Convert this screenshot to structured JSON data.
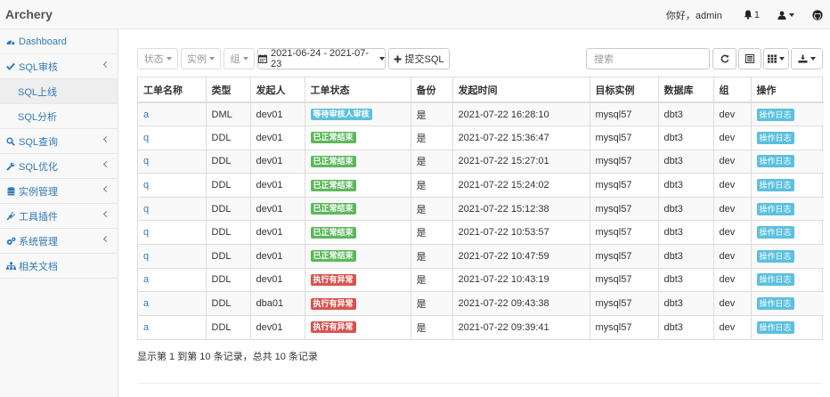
{
  "navbar": {
    "brand": "Archery",
    "greeting": "你好，admin",
    "notification_count": "1"
  },
  "sidebar": {
    "items": [
      {
        "label": "Dashboard",
        "icon": "dashboard-icon"
      },
      {
        "label": "SQL审核",
        "icon": "check-icon"
      },
      {
        "label": "SQL上线"
      },
      {
        "label": "SQL分析"
      },
      {
        "label": "SQL查询",
        "icon": "search-icon"
      },
      {
        "label": "SQL优化",
        "icon": "wrench-icon"
      },
      {
        "label": "实例管理",
        "icon": "database-icon"
      },
      {
        "label": "工具插件",
        "icon": "plug-icon"
      },
      {
        "label": "系统管理",
        "icon": "gears-icon"
      },
      {
        "label": "相关文档",
        "icon": "sitemap-icon"
      }
    ]
  },
  "toolbar": {
    "status_filter": "状态",
    "instance_filter": "实例",
    "group_filter": "组",
    "date_range": "2021-06-24 - 2021-07-23",
    "submit_sql": "提交SQL",
    "search_placeholder": "搜索"
  },
  "table": {
    "headers": [
      "工单名称",
      "类型",
      "发起人",
      "工单状态",
      "备份",
      "发起时间",
      "目标实例",
      "数据库",
      "组",
      "操作"
    ],
    "rows": [
      {
        "name": "a",
        "type": "DML",
        "user": "dev01",
        "status": "等待审核人审核",
        "status_kind": "info",
        "backup": "是",
        "time": "2021-07-22 16:28:10",
        "instance": "mysql57",
        "db": "dbt3",
        "group": "dev",
        "action": "操作日志"
      },
      {
        "name": "q",
        "type": "DDL",
        "user": "dev01",
        "status": "已正常结束",
        "status_kind": "success",
        "backup": "是",
        "time": "2021-07-22 15:36:47",
        "instance": "mysql57",
        "db": "dbt3",
        "group": "dev",
        "action": "操作日志"
      },
      {
        "name": "q",
        "type": "DDL",
        "user": "dev01",
        "status": "已正常结束",
        "status_kind": "success",
        "backup": "是",
        "time": "2021-07-22 15:27:01",
        "instance": "mysql57",
        "db": "dbt3",
        "group": "dev",
        "action": "操作日志"
      },
      {
        "name": "q",
        "type": "DDL",
        "user": "dev01",
        "status": "已正常结束",
        "status_kind": "success",
        "backup": "是",
        "time": "2021-07-22 15:24:02",
        "instance": "mysql57",
        "db": "dbt3",
        "group": "dev",
        "action": "操作日志"
      },
      {
        "name": "q",
        "type": "DDL",
        "user": "dev01",
        "status": "已正常结束",
        "status_kind": "success",
        "backup": "是",
        "time": "2021-07-22 15:12:38",
        "instance": "mysql57",
        "db": "dbt3",
        "group": "dev",
        "action": "操作日志"
      },
      {
        "name": "q",
        "type": "DDL",
        "user": "dev01",
        "status": "已正常结束",
        "status_kind": "success",
        "backup": "是",
        "time": "2021-07-22 10:53:57",
        "instance": "mysql57",
        "db": "dbt3",
        "group": "dev",
        "action": "操作日志"
      },
      {
        "name": "q",
        "type": "DDL",
        "user": "dev01",
        "status": "已正常结束",
        "status_kind": "success",
        "backup": "是",
        "time": "2021-07-22 10:47:59",
        "instance": "mysql57",
        "db": "dbt3",
        "group": "dev",
        "action": "操作日志"
      },
      {
        "name": "a",
        "type": "DDL",
        "user": "dev01",
        "status": "执行有异常",
        "status_kind": "danger",
        "backup": "是",
        "time": "2021-07-22 10:43:19",
        "instance": "mysql57",
        "db": "dbt3",
        "group": "dev",
        "action": "操作日志"
      },
      {
        "name": "a",
        "type": "DDL",
        "user": "dba01",
        "status": "执行有异常",
        "status_kind": "danger",
        "backup": "是",
        "time": "2021-07-22 09:43:38",
        "instance": "mysql57",
        "db": "dbt3",
        "group": "dev",
        "action": "操作日志"
      },
      {
        "name": "a",
        "type": "DDL",
        "user": "dev01",
        "status": "执行有异常",
        "status_kind": "danger",
        "backup": "是",
        "time": "2021-07-22 09:39:41",
        "instance": "mysql57",
        "db": "dbt3",
        "group": "dev",
        "action": "操作日志"
      }
    ]
  },
  "pagination": {
    "summary": "显示第 1 到第 10 条记录，总共 10 条记录"
  }
}
